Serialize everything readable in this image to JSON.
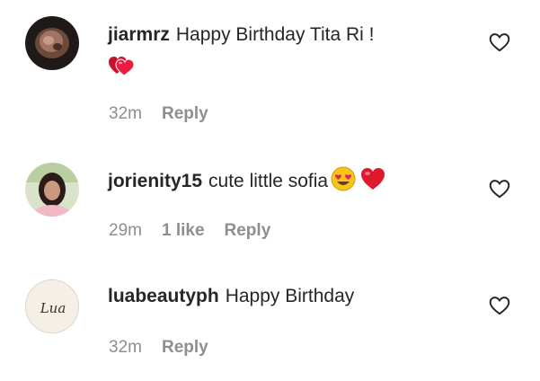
{
  "comments": [
    {
      "username": "jiarmrz",
      "text": "Happy Birthday Tita Ri !",
      "emojis": [
        "two-hearts-icon"
      ],
      "time": "32m",
      "likes": "",
      "reply_label": "Reply",
      "avatar": "photo"
    },
    {
      "username": "jorienity15",
      "text": "cute little sofia",
      "emojis": [
        "heart-eyes-emoji-icon",
        "red-heart-icon"
      ],
      "time": "29m",
      "likes": "1 like",
      "reply_label": "Reply",
      "avatar": "photo"
    },
    {
      "username": "luabeautyph",
      "text": "Happy Birthday",
      "emojis": [],
      "time": "32m",
      "likes": "",
      "reply_label": "Reply",
      "avatar": "logo",
      "avatar_logo_text": "Lua"
    }
  ],
  "colors": {
    "text": "#262626",
    "meta": "#8e8e8e",
    "heart": "#ed1c40",
    "background": "#ffffff"
  }
}
